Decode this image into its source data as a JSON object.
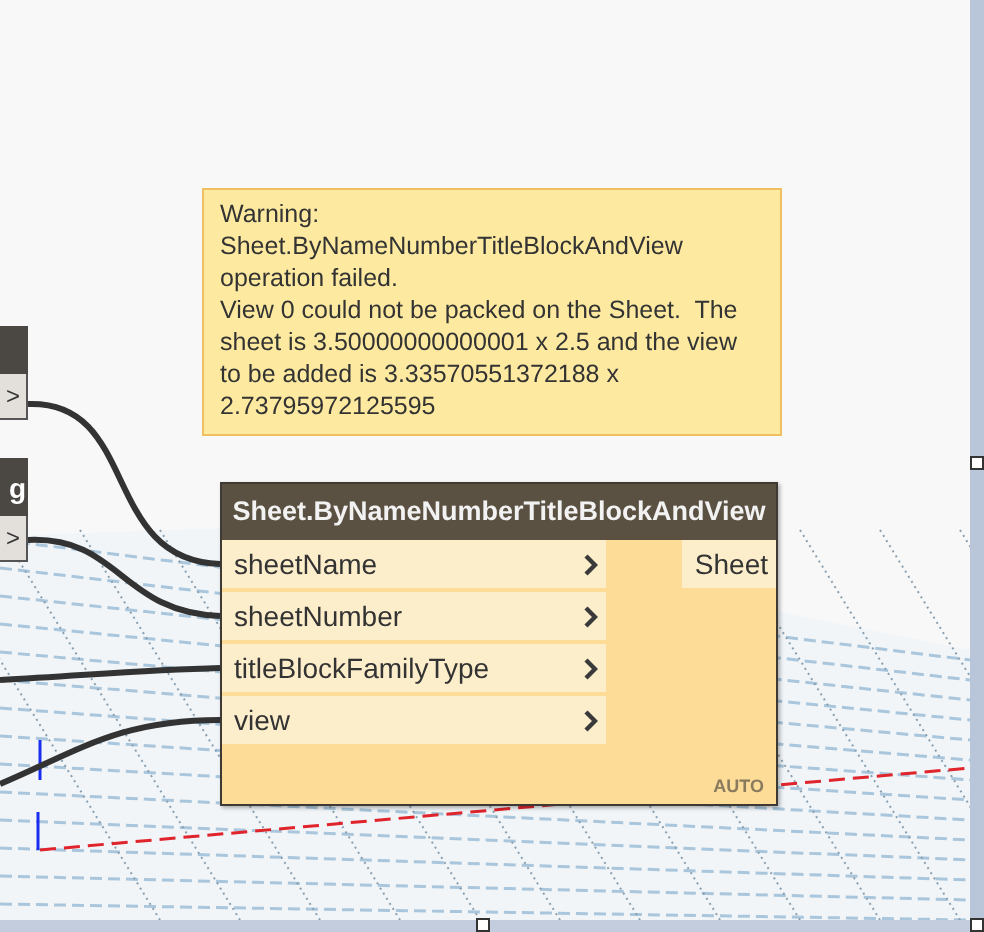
{
  "offscreen_nodes": [
    {
      "port": ">"
    },
    {
      "title": "g",
      "port": ">"
    }
  ],
  "tooltip": {
    "lines": [
      "Warning:",
      "Sheet.ByNameNumberTitleBlockAndView",
      "operation failed.",
      "View 0 could not be packed on the Sheet.  The",
      "sheet is 3.50000000000001 x 2.5 and the view",
      "to be added is 3.33570551372188 x",
      "2.73795972125595"
    ]
  },
  "node": {
    "title": "Sheet.ByNameNumberTitleBlockAndView",
    "inputs": [
      {
        "name": "sheetName"
      },
      {
        "name": "sheetNumber"
      },
      {
        "name": "titleBlockFamilyType"
      },
      {
        "name": "view"
      }
    ],
    "outputs": [
      "Sheet"
    ],
    "run_mode": "AUTO"
  }
}
